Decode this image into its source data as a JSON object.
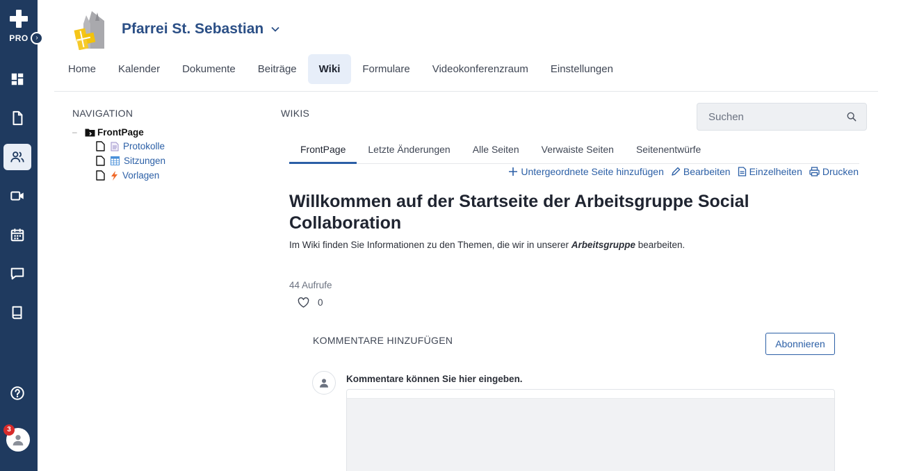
{
  "rail": {
    "product": "PRO",
    "items": [
      {
        "icon": "dashboard-icon"
      },
      {
        "icon": "document-icon"
      },
      {
        "icon": "users-icon",
        "active": true
      },
      {
        "icon": "video-icon"
      },
      {
        "icon": "calendar-icon"
      },
      {
        "icon": "chat-icon"
      },
      {
        "icon": "book-icon"
      }
    ],
    "help_icon": "help-icon",
    "notification_count": "3"
  },
  "header": {
    "title": "Pfarrei St. Sebastian",
    "nav": [
      {
        "label": "Home"
      },
      {
        "label": "Kalender"
      },
      {
        "label": "Dokumente"
      },
      {
        "label": "Beiträge"
      },
      {
        "label": "Wiki",
        "active": true
      },
      {
        "label": "Formulare"
      },
      {
        "label": "Videokonferenzraum"
      },
      {
        "label": "Einstellungen"
      }
    ]
  },
  "navigation": {
    "title": "NAVIGATION",
    "root": {
      "label": "FrontPage"
    },
    "children": [
      {
        "label": "Protokolle",
        "icon": "page-icon"
      },
      {
        "label": "Sitzungen",
        "icon": "table-icon"
      },
      {
        "label": "Vorlagen",
        "icon": "lightning-icon"
      }
    ]
  },
  "wikis": {
    "title": "WIKIS",
    "search_placeholder": "Suchen",
    "tabs": [
      {
        "label": "FrontPage",
        "active": true
      },
      {
        "label": "Letzte Änderungen"
      },
      {
        "label": "Alle Seiten"
      },
      {
        "label": "Verwaiste Seiten"
      },
      {
        "label": "Seitenentwürfe"
      }
    ],
    "actions": {
      "add_child": "Untergeordnete Seite hinzufügen",
      "edit": "Bearbeiten",
      "details": "Einzelheiten",
      "print": "Drucken"
    }
  },
  "page": {
    "heading": "Willkommen auf der Startseite der Arbeitsgruppe Social Collaboration",
    "intro_before": "Im Wiki finden Sie Informationen zu den Themen, die wir in unserer ",
    "intro_emphasis": "Arbeitsgruppe",
    "intro_after": " bearbeiten.",
    "views": "44 Aufrufe",
    "likes": "0"
  },
  "comments": {
    "title": "KOMMENTARE HINZUFÜGEN",
    "subscribe_label": "Abonnieren",
    "prompt": "Kommentare können Sie hier eingeben."
  },
  "colors": {
    "rail": "#1f3a5f",
    "accent": "#2b5fa6",
    "brand": "#2b4f86"
  }
}
